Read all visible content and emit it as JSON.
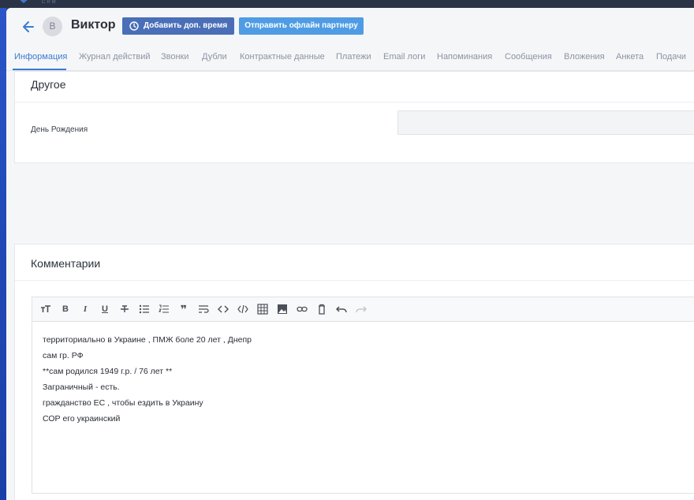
{
  "app": {
    "logo_text": "CRM"
  },
  "header": {
    "avatar_initial": "В",
    "name": "Виктор",
    "add_time_button": "Добавить доп. время",
    "send_offline_button": "Отправить офлайн партнеру"
  },
  "tabs": [
    {
      "label": "Информация",
      "active": true
    },
    {
      "label": "Журнал действий"
    },
    {
      "label": "Звонки"
    },
    {
      "label": "Дубли"
    },
    {
      "label": "Контрактные данные"
    },
    {
      "label": "Платежи"
    },
    {
      "label": "Email логи"
    },
    {
      "label": "Напоминания"
    },
    {
      "label": "Сообщения"
    },
    {
      "label": "Вложения"
    },
    {
      "label": "Анкета"
    },
    {
      "label": "Подачи"
    }
  ],
  "other_section": {
    "title": "Другое",
    "birthday_label": "День Рождения",
    "birthday_value": ""
  },
  "comments_section": {
    "title": "Комментарии",
    "toolbar_icons": [
      "text-size-icon",
      "bold-icon",
      "italic-icon",
      "underline-icon",
      "strikethrough-icon",
      "bullet-list-icon",
      "numbered-list-icon",
      "quote-icon",
      "wrap-icon",
      "code-icon",
      "code-block-icon",
      "table-icon",
      "image-icon",
      "link-icon",
      "delete-icon",
      "undo-icon",
      "redo-icon"
    ],
    "lines": [
      "территориально  в Украине , ПМЖ  боле 20 лет , Днепр",
      "сам гр. РФ",
      "**сам родился 1949 г.р. / 76 лет **",
      "Заграничный - есть.",
      "гражданство ЕС , чтобы ездить в Украину",
      "СОР его украинский"
    ]
  },
  "colors": {
    "accent": "#3b7bd1",
    "primary_button": "#4a6fb8",
    "secondary_button": "#4f9ce4"
  }
}
